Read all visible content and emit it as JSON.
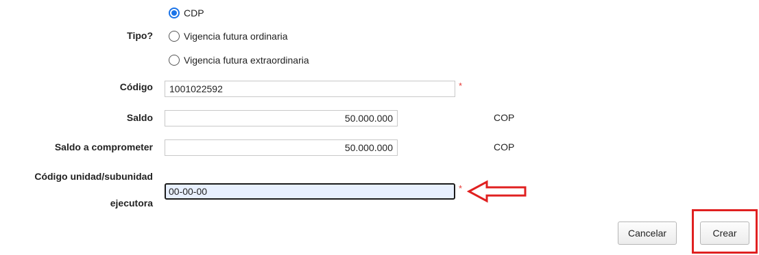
{
  "form": {
    "tipo": {
      "label": "Tipo?",
      "options": [
        {
          "label": "CDP",
          "checked": true
        },
        {
          "label": "Vigencia futura ordinaria",
          "checked": false
        },
        {
          "label": "Vigencia futura extraordinaria",
          "checked": false
        }
      ]
    },
    "codigo": {
      "label": "Código",
      "value": "1001022592",
      "required_mark": "*"
    },
    "saldo": {
      "label": "Saldo",
      "value": "50.000.000",
      "unit": "COP"
    },
    "saldo_comprometer": {
      "label": "Saldo a comprometer",
      "value": "50.000.000",
      "unit": "COP"
    },
    "codigo_unidad": {
      "label_line1": "Código unidad/subunidad",
      "label_line2": "ejecutora",
      "value": "00-00-00",
      "required_mark": "*"
    }
  },
  "actions": {
    "cancel_label": "Cancelar",
    "create_label": "Crear"
  },
  "annotations": {
    "arrow_color": "#e02020",
    "highlight_color": "#e02020"
  },
  "colors": {
    "radio_accent": "#1a73e8",
    "focused_field_bg": "#e8f0fe",
    "required": "#e53935"
  }
}
